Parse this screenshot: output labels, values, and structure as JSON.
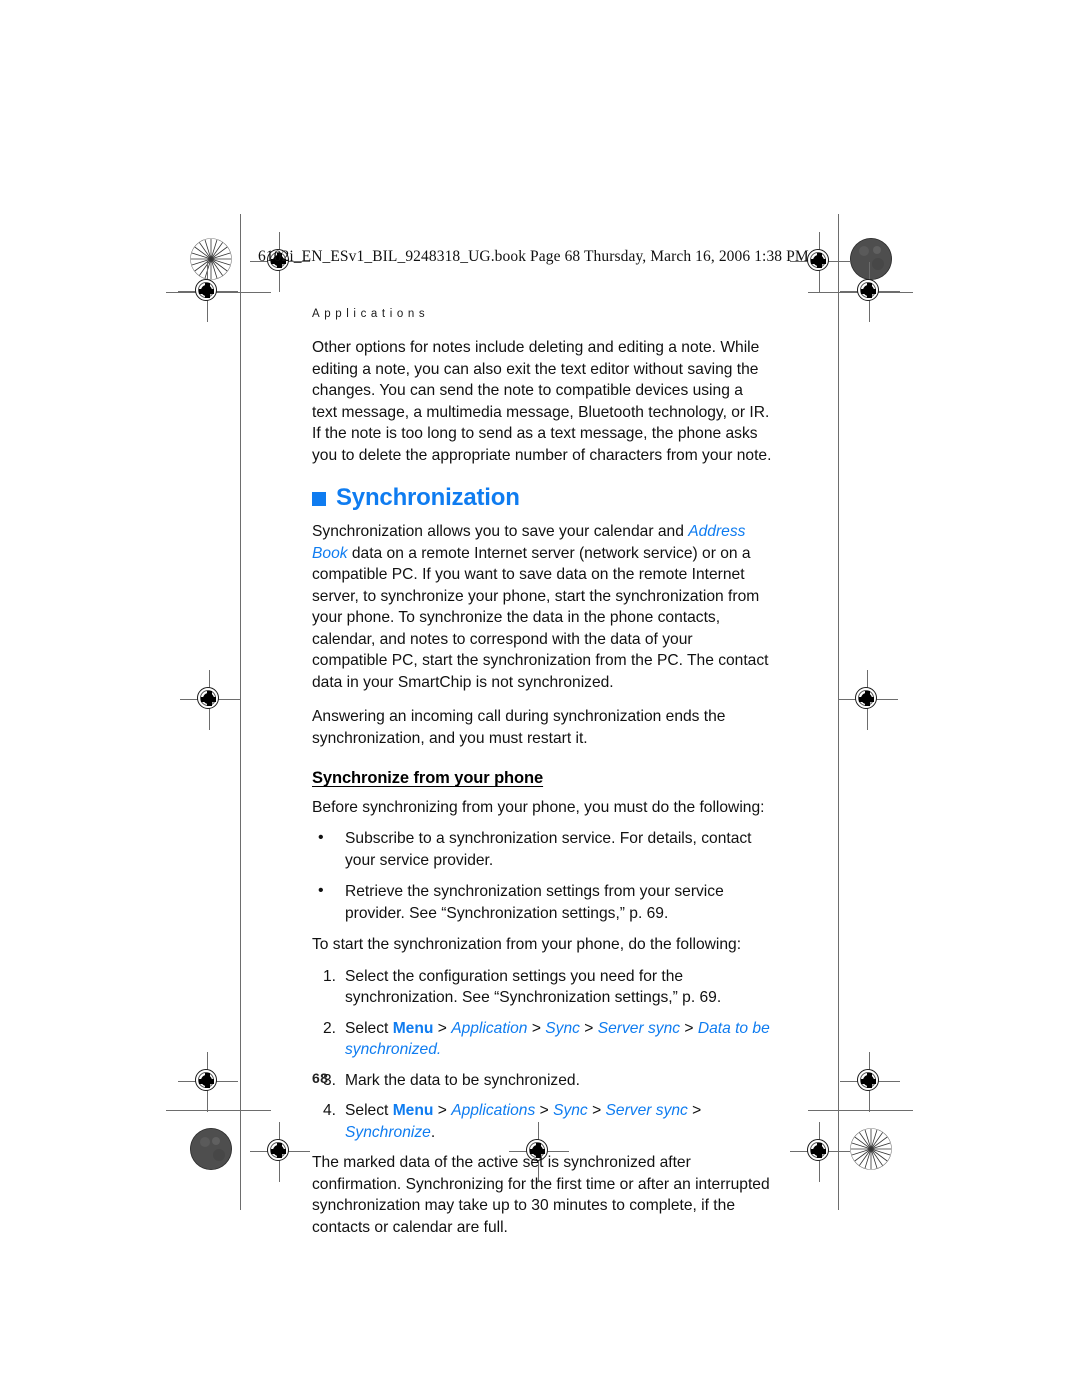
{
  "print_marks": {
    "rosette_icon": "rosette-registration-target",
    "density_icon": "density-patch-circle",
    "crosshair_icon": "crosshair-registration-mark"
  },
  "header": {
    "file_line": "6102i_EN_ESv1_BIL_9248318_UG.book  Page 68  Thursday, March 16, 2006  1:38 PM",
    "running_head": "Applications"
  },
  "body": {
    "intro_paragraph": "Other options for notes include deleting and editing a note. While editing a note, you can also exit the text editor without saving the changes. You can send the note to compatible devices using a text message, a multimedia message, Bluetooth technology, or IR. If the note is too long to send as a text message, the phone asks you to delete the appropriate number of characters from your note.",
    "section_title": "Synchronization",
    "sync_para_1_before": "Synchronization allows you to save your calendar and ",
    "sync_para_1_italic": "Address Book",
    "sync_para_1_after": " data on a remote Internet server (network service) or on a compatible PC. If you want to save data on the remote Internet server, to synchronize your phone, start the synchronization from your phone. To synchronize the data in the phone contacts, calendar, and notes to correspond with the data of your compatible PC, start the synchronization from the PC. The contact data in your SmartChip is not synchronized.",
    "sync_para_2": "Answering an incoming call during synchronization ends the synchronization, and you must restart it.",
    "sub_title": "Synchronize from your phone",
    "before_sync_lead": "Before synchronizing from your phone, you must do the following:",
    "bullets": [
      "Subscribe to a synchronization service. For details, contact your service provider.",
      "Retrieve the synchronization settings from your service provider. See “Synchronization settings,” p. 69."
    ],
    "start_sync_lead": "To start the synchronization from your phone, do the following:",
    "steps": [
      {
        "num": "1.",
        "text": "Select the configuration settings you need for the synchronization. See “Synchronization settings,” p. 69."
      },
      {
        "num": "2.",
        "prefix": "Select ",
        "keyword": "Menu",
        "path": [
          "Application",
          "Sync",
          "Server sync",
          "Data to be synchronized"
        ],
        "separator": " > ",
        "suffix": "."
      },
      {
        "num": "3.",
        "text": "Mark the data to be synchronized."
      },
      {
        "num": "4.",
        "prefix": "Select ",
        "keyword": "Menu",
        "path": [
          "Applications",
          "Sync",
          "Server sync",
          "Synchronize"
        ],
        "separator": " > ",
        "suffix": "."
      }
    ],
    "closing_paragraph": "The marked data of the active set is synchronized after confirmation. Synchronizing for the first time or after an interrupted synchronization may take up to 30 minutes to complete, if the contacts or calendar are full."
  },
  "footer": {
    "page_number": "68"
  },
  "colors": {
    "accent_blue": "#0f7cf0",
    "text_black": "#111111",
    "mark_gray": "#6d6d6d"
  }
}
